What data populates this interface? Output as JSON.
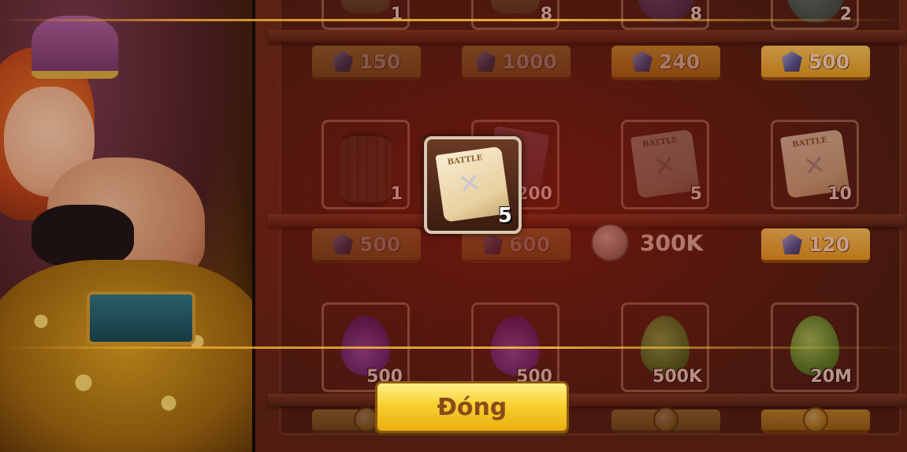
{
  "shop": {
    "row0": {
      "qty": [
        "1",
        "8",
        "8",
        "2"
      ],
      "prices": [
        "150",
        "1000",
        "240",
        "500"
      ]
    },
    "row1": {
      "qty": [
        "1",
        "200",
        "5",
        "10"
      ],
      "prices": [
        "500",
        "600",
        "300K",
        "120"
      ]
    },
    "row2": {
      "qty": [
        "500",
        "500",
        "500K",
        "20M"
      ]
    }
  },
  "highlight": {
    "qty": "5"
  },
  "icons": {
    "gem": "gem-icon",
    "coin": "coin-icon",
    "scroll": "battle-scroll-icon",
    "barrel": "barrel-icon",
    "drop": "fruit-drop-icon"
  },
  "colors": {
    "button": "#f8d030",
    "price": "#e8b83a",
    "tint": "#96140a"
  },
  "close_button": {
    "label": "Đóng"
  }
}
